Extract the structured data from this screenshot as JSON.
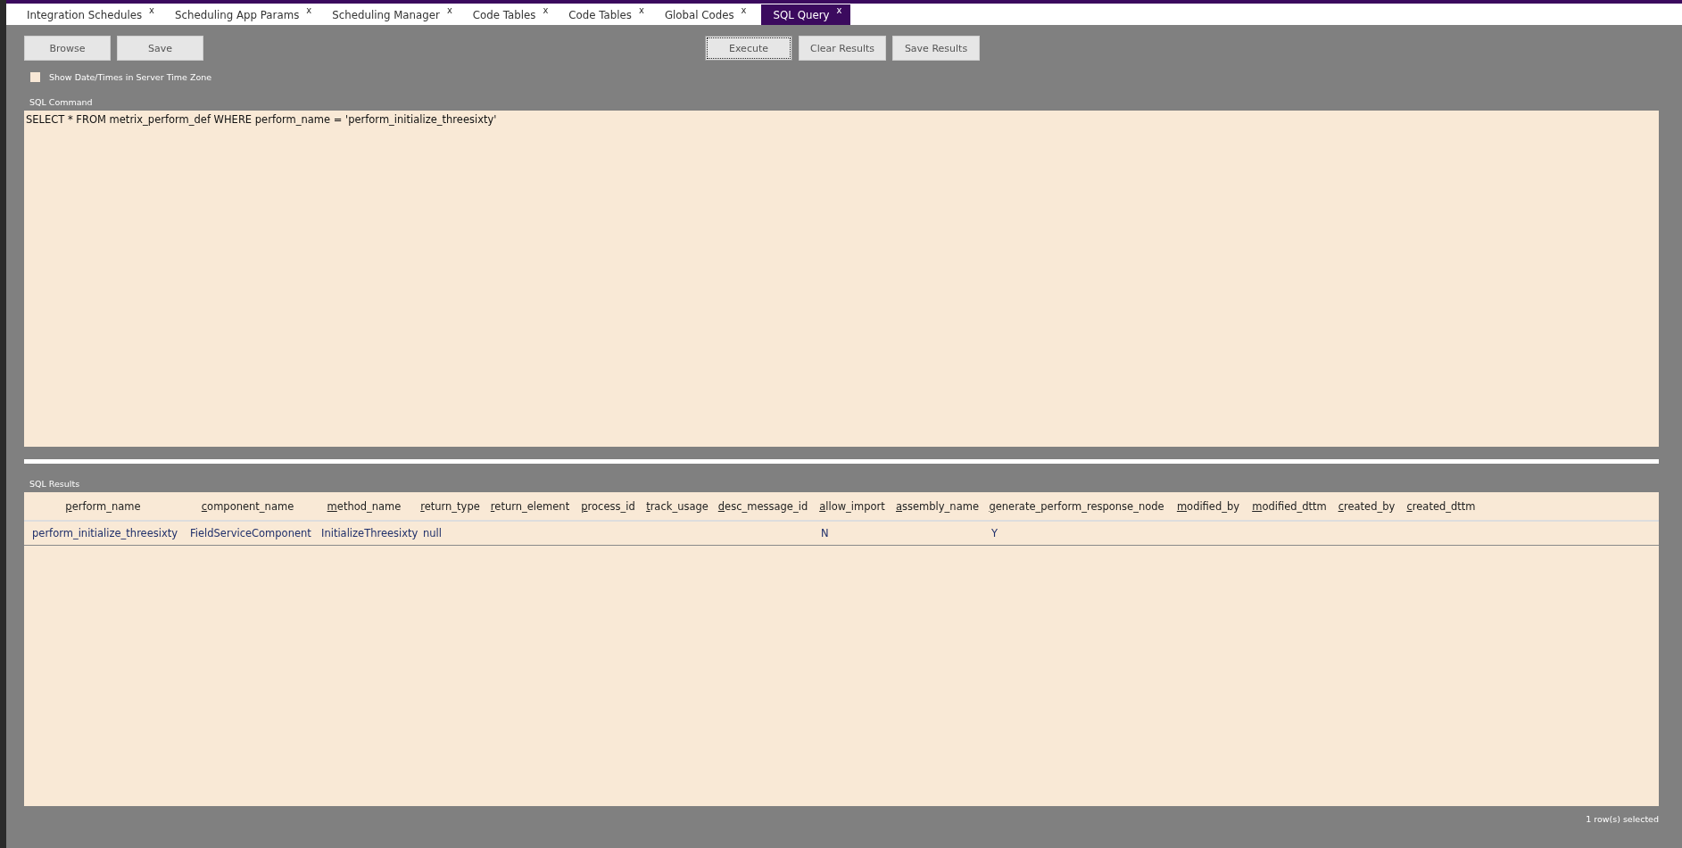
{
  "tabs": [
    {
      "label": "Integration Schedules",
      "close": "x",
      "selected": false
    },
    {
      "label": "Scheduling App Params",
      "close": "x",
      "selected": false
    },
    {
      "label": "Scheduling Manager",
      "close": "x",
      "selected": false
    },
    {
      "label": "Code Tables",
      "close": "x",
      "selected": false
    },
    {
      "label": "Code Tables",
      "close": "x",
      "selected": false
    },
    {
      "label": "Global Codes",
      "close": "x",
      "selected": false
    },
    {
      "label": "SQL Query",
      "close": "x",
      "selected": true
    }
  ],
  "left_buttons": [
    "Browse",
    "Save"
  ],
  "right_buttons": [
    {
      "label": "Execute",
      "focused": true
    },
    {
      "label": "Clear Results",
      "focused": false
    },
    {
      "label": "Save Results",
      "focused": false
    }
  ],
  "server_time_zone": {
    "label": "Show Date/Times in Server Time Zone",
    "checked": false
  },
  "sql_command": {
    "label": "SQL Command",
    "value": "SELECT * FROM metrix_perform_def WHERE perform_name = 'perform_initialize_threesixty'"
  },
  "results": {
    "label": "SQL Results",
    "columns": [
      "perform_name",
      "component_name",
      "method_name",
      "return_type",
      "return_element",
      "process_id",
      "track_usage",
      "desc_message_id",
      "allow_import",
      "assembly_name",
      "generate_perform_response_node",
      "modified_by",
      "modified_dttm",
      "created_by",
      "created_dttm"
    ],
    "rows": [
      {
        "selected": true,
        "cells": [
          "perform_initialize_threesixty",
          "FieldServiceComponent",
          "InitializeThreesixty",
          "null",
          "",
          "",
          "",
          "",
          "N",
          "",
          "Y",
          "",
          "",
          "",
          ""
        ]
      }
    ]
  },
  "status_bar": "1 row(s) selected"
}
